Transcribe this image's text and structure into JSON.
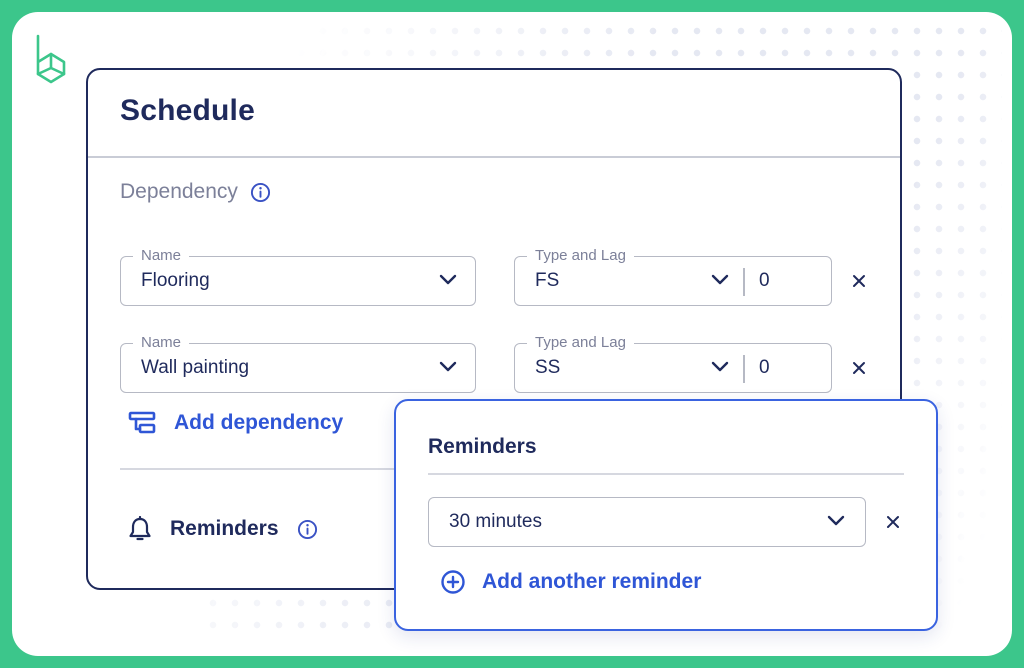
{
  "schedule": {
    "title": "Schedule",
    "dependency_label": "Dependency",
    "rows": [
      {
        "name_label": "Name",
        "name_value": "Flooring",
        "type_label": "Type and Lag",
        "type_value": "FS",
        "lag_value": "0"
      },
      {
        "name_label": "Name",
        "name_value": "Wall painting",
        "type_label": "Type and Lag",
        "type_value": "SS",
        "lag_value": "0"
      }
    ],
    "add_dependency_label": "Add dependency",
    "reminders_label": "Reminders"
  },
  "reminders_popup": {
    "title": "Reminders",
    "selected_value": "30 minutes",
    "add_another_label": "Add another reminder"
  },
  "colors": {
    "background": "#3cc68b",
    "navy": "#1f2a5c",
    "accent_blue": "#2f56d6",
    "muted_text": "#7c8099"
  },
  "icons": [
    "logo-icon",
    "info-icon",
    "chevron-down-icon",
    "close-icon",
    "dependency-icon",
    "bell-icon",
    "plus-circle-icon"
  ]
}
